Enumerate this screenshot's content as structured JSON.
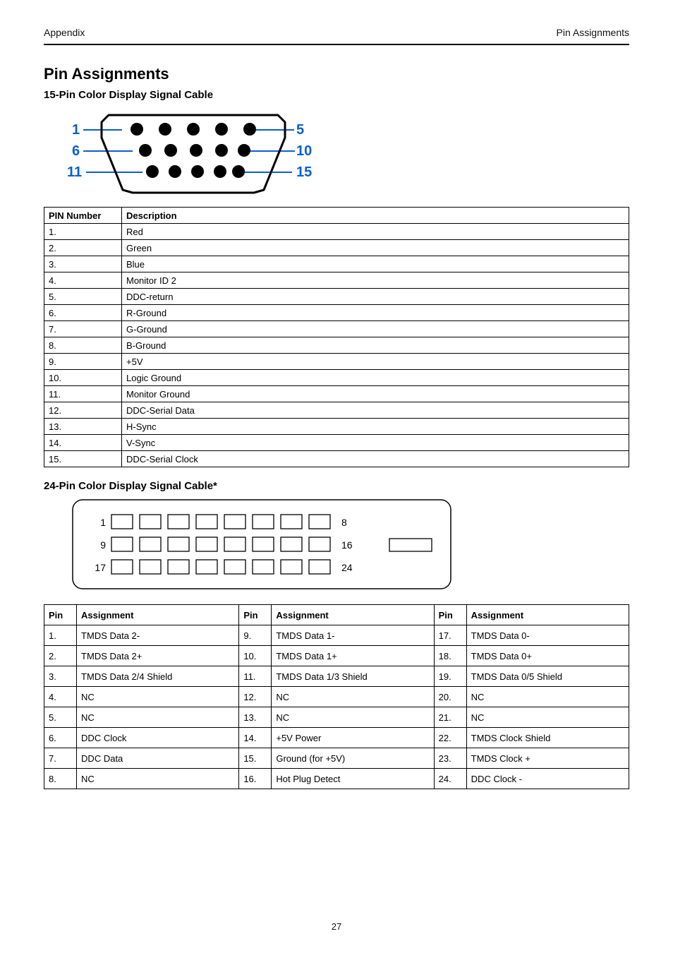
{
  "header": {
    "left": "Appendix",
    "right": "Pin Assignments"
  },
  "section_title": "Pin Assignments",
  "vga_section_title": "15-Pin Color Display Signal Cable",
  "dvi_section_title": "24-Pin Color Display Signal Cable*",
  "vga_diagram_labels": {
    "tl": "1",
    "ml": "6",
    "bl": "11",
    "tr": "5",
    "mr": "10",
    "br": "15"
  },
  "vga_table": {
    "headers": [
      "PIN Number",
      "Description"
    ],
    "rows": [
      [
        "1.",
        "Red"
      ],
      [
        "2.",
        "Green"
      ],
      [
        "3.",
        "Blue"
      ],
      [
        "4.",
        "Monitor ID 2"
      ],
      [
        "5.",
        "DDC-return"
      ],
      [
        "6.",
        "R-Ground"
      ],
      [
        "7.",
        "G-Ground"
      ],
      [
        "8.",
        "B-Ground"
      ],
      [
        "9.",
        "+5V"
      ],
      [
        "10.",
        "Logic Ground"
      ],
      [
        "11.",
        "Monitor Ground"
      ],
      [
        "12.",
        "DDC-Serial Data"
      ],
      [
        "13.",
        "H-Sync"
      ],
      [
        "14.",
        "V-Sync"
      ],
      [
        "15.",
        "DDC-Serial Clock"
      ]
    ]
  },
  "dvi_diagram_labels": {
    "r1s": "1",
    "r1e": "8",
    "r2s": "9",
    "r2e": "16",
    "r3s": "17",
    "r3e": "24"
  },
  "dvi_table": {
    "headers": [
      "Pin",
      "Assignment",
      "Pin",
      "Assignment",
      "Pin",
      "Assignment"
    ],
    "rows": [
      [
        "1.",
        "TMDS Data 2-",
        "9.",
        "TMDS Data 1-",
        "17.",
        "TMDS Data 0-"
      ],
      [
        "2.",
        "TMDS Data 2+",
        "10.",
        "TMDS Data 1+",
        "18.",
        "TMDS Data 0+"
      ],
      [
        "3.",
        "TMDS Data 2/4 Shield",
        "11.",
        "TMDS Data 1/3 Shield",
        "19.",
        "TMDS Data 0/5 Shield"
      ],
      [
        "4.",
        "NC",
        "12.",
        "NC",
        "20.",
        "NC"
      ],
      [
        "5.",
        "NC",
        "13.",
        "NC",
        "21.",
        "NC"
      ],
      [
        "6.",
        "DDC Clock",
        "14.",
        "+5V Power",
        "22.",
        "TMDS Clock Shield"
      ],
      [
        "7.",
        "DDC Data",
        "15.",
        "Ground (for +5V)",
        "23.",
        "TMDS Clock +"
      ],
      [
        "8.",
        "NC",
        "16.",
        "Hot Plug Detect",
        "24.",
        "DDC Clock -"
      ]
    ]
  },
  "footer": "27"
}
